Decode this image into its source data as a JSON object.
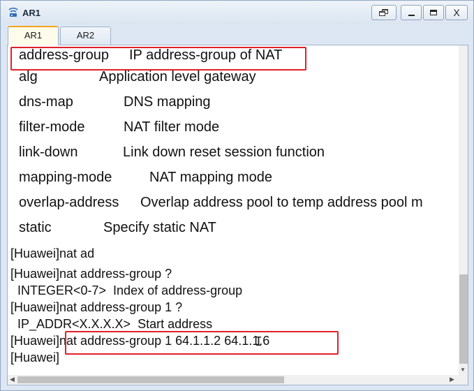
{
  "window": {
    "title": "AR1",
    "icon": "router-terminal-icon",
    "controls": [
      "restore-icon",
      "minimize-icon",
      "maximize-icon",
      "close-icon"
    ],
    "close_glyph": "X"
  },
  "tabs": [
    {
      "label": "AR1",
      "active": true
    },
    {
      "label": "AR2",
      "active": false
    }
  ],
  "terminal": {
    "options": [
      {
        "cmd": "address-group",
        "desc": "IP address-group of NAT"
      },
      {
        "cmd": "alg",
        "desc": "Application level gateway"
      },
      {
        "cmd": "dns-map",
        "desc": "DNS mapping"
      },
      {
        "cmd": "filter-mode",
        "desc": "NAT filter mode"
      },
      {
        "cmd": "link-down",
        "desc": "Link down reset session function"
      },
      {
        "cmd": "mapping-mode",
        "desc": "NAT mapping mode"
      },
      {
        "cmd": "overlap-address",
        "desc": "Overlap address pool to temp address pool m"
      },
      {
        "cmd": "static",
        "desc": "Specify static NAT"
      }
    ],
    "lines": [
      "[Huawei]nat ad",
      "[Huawei]nat address-group ?",
      "  INTEGER<0-7>  Index of address-group",
      "[Huawei]nat address-group 1 ?",
      "  IP_ADDR<X.X.X.X>  Start address",
      "[Huawei]nat address-group 1 64.1.1.2 64.1.1.6",
      "[Huawei]"
    ],
    "highlight_color": "#e0202a"
  }
}
